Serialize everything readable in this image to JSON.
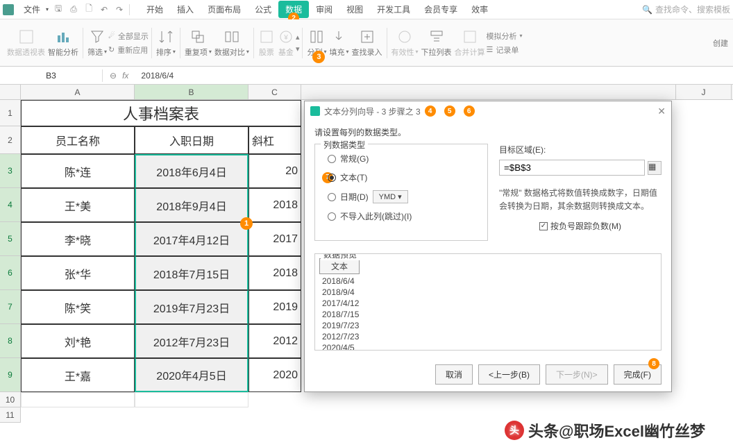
{
  "menubar": {
    "file": "文件"
  },
  "tabs": {
    "start": "开始",
    "insert": "插入",
    "layout": "页面布局",
    "formula": "公式",
    "data": "数据",
    "review": "审阅",
    "view": "视图",
    "dev": "开发工具",
    "vip": "会员专享",
    "efficiency": "效率"
  },
  "tab_badge": "2",
  "search_placeholder": "查找命令、搜索模板",
  "ribbon": {
    "pivot": "数据透视表",
    "smart": "智能分析",
    "filter": "筛选",
    "sort": "排序",
    "showall": "全部显示",
    "reapply": "重新应用",
    "dup": "重复项",
    "compare": "数据对比",
    "stock": "股票",
    "fund": "基金",
    "split": "分列",
    "fill": "填充",
    "find": "查找录入",
    "validity": "有效性",
    "dropdown": "下拉列表",
    "consolidate": "合并计算",
    "record": "记录单",
    "sim": "模拟分析",
    "create": "创建"
  },
  "ribbon_badge": "3",
  "namebox": "B3",
  "formula": "2018/6/4",
  "columns": [
    "A",
    "B",
    "C",
    "J"
  ],
  "col_widths": {
    "A": 164,
    "B": 164,
    "C": 76,
    "J": 80
  },
  "row_heights": {
    "title": 38,
    "header": 40,
    "data": 49,
    "small": 22
  },
  "sheet": {
    "title": "人事档案表",
    "headers": [
      "员工名称",
      "入职日期",
      "斜杠"
    ],
    "rows": [
      {
        "n": "3",
        "a": "陈*连",
        "b": "2018年6月4日",
        "c": "20"
      },
      {
        "n": "4",
        "a": "王*美",
        "b": "2018年9月4日",
        "c": "2018"
      },
      {
        "n": "5",
        "a": "李*晓",
        "b": "2017年4月12日",
        "c": "2017"
      },
      {
        "n": "6",
        "a": "张*华",
        "b": "2018年7月15日",
        "c": "2018"
      },
      {
        "n": "7",
        "a": "陈*笑",
        "b": "2019年7月23日",
        "c": "2019"
      },
      {
        "n": "8",
        "a": "刘*艳",
        "b": "2012年7月23日",
        "c": "2012"
      },
      {
        "n": "9",
        "a": "王*嘉",
        "b": "2020年4月5日",
        "c": "2020"
      }
    ]
  },
  "cell_badge": "1",
  "dialog": {
    "title": "文本分列向导 - 3 步骤之 3",
    "badges": [
      "4",
      "5",
      "6"
    ],
    "msg": "请设置每列的数据类型。",
    "group_type": "列数据类型",
    "radio_general": "常规(G)",
    "radio_text": "文本(T)",
    "radio_text_badge": "7",
    "radio_date": "日期(D)",
    "date_fmt": "YMD",
    "radio_skip": "不导入此列(跳过)(I)",
    "target_label": "目标区域(E):",
    "target_value": "=$B$3",
    "note": "\"常规\" 数据格式将数值转换成数字，日期值会转换为日期，其余数据则转换成文本。",
    "chk_neg": "按负号跟踪负数(M)",
    "preview_label": "数据预览",
    "preview_header": "文本",
    "preview_vals": [
      "2018/6/4",
      "2018/9/4",
      "2017/4/12",
      "2018/7/15",
      "2019/7/23",
      "2012/7/23",
      "2020/4/5"
    ],
    "btn_cancel": "取消",
    "btn_back": "<上一步(B)",
    "btn_next": "下一步(N)>",
    "btn_finish": "完成(F)",
    "btn_finish_badge": "8"
  },
  "watermark": "头条@职场Excel幽竹丝梦"
}
